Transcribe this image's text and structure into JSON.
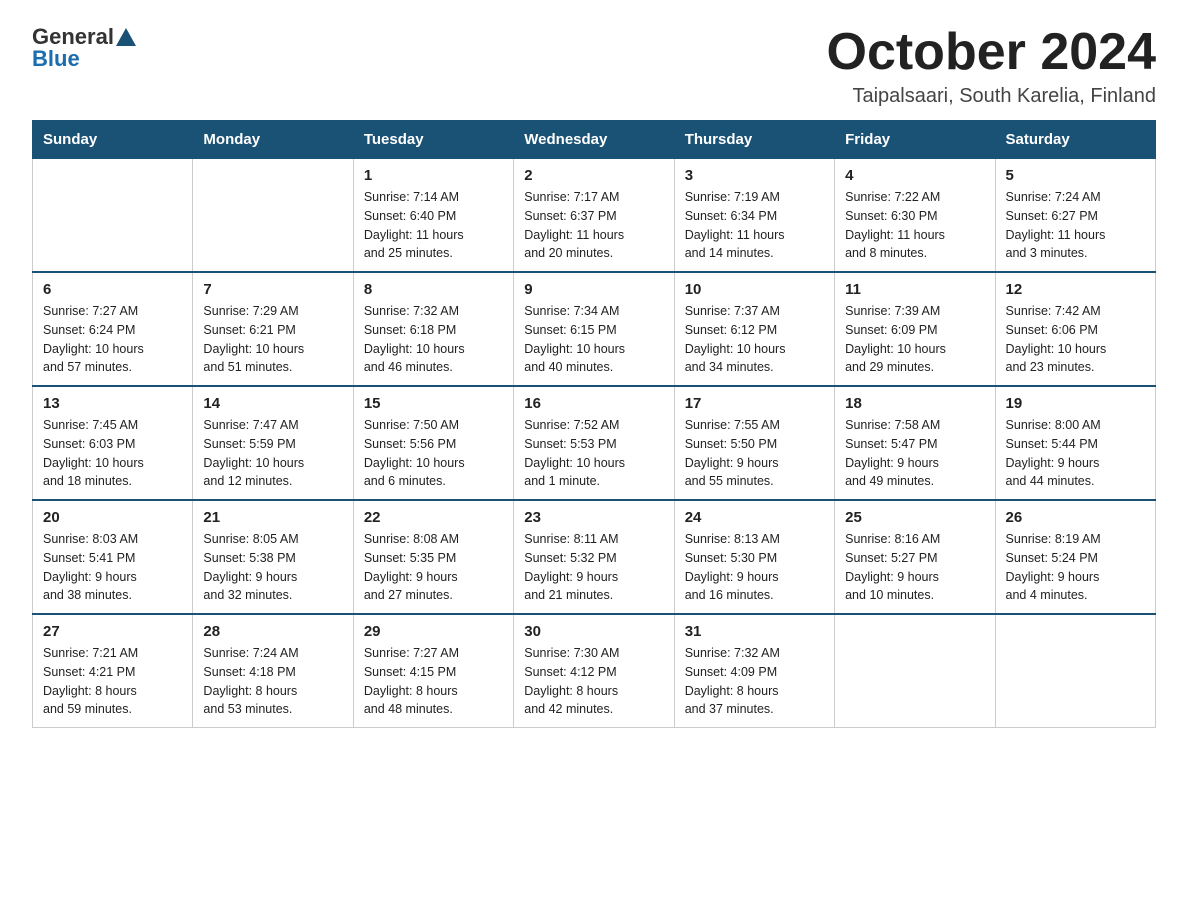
{
  "header": {
    "logo": {
      "general": "General",
      "blue": "Blue"
    },
    "month": "October 2024",
    "location": "Taipalsaari, South Karelia, Finland"
  },
  "days_of_week": [
    "Sunday",
    "Monday",
    "Tuesday",
    "Wednesday",
    "Thursday",
    "Friday",
    "Saturday"
  ],
  "weeks": [
    [
      {
        "day": "",
        "info": ""
      },
      {
        "day": "",
        "info": ""
      },
      {
        "day": "1",
        "info": "Sunrise: 7:14 AM\nSunset: 6:40 PM\nDaylight: 11 hours\nand 25 minutes."
      },
      {
        "day": "2",
        "info": "Sunrise: 7:17 AM\nSunset: 6:37 PM\nDaylight: 11 hours\nand 20 minutes."
      },
      {
        "day": "3",
        "info": "Sunrise: 7:19 AM\nSunset: 6:34 PM\nDaylight: 11 hours\nand 14 minutes."
      },
      {
        "day": "4",
        "info": "Sunrise: 7:22 AM\nSunset: 6:30 PM\nDaylight: 11 hours\nand 8 minutes."
      },
      {
        "day": "5",
        "info": "Sunrise: 7:24 AM\nSunset: 6:27 PM\nDaylight: 11 hours\nand 3 minutes."
      }
    ],
    [
      {
        "day": "6",
        "info": "Sunrise: 7:27 AM\nSunset: 6:24 PM\nDaylight: 10 hours\nand 57 minutes."
      },
      {
        "day": "7",
        "info": "Sunrise: 7:29 AM\nSunset: 6:21 PM\nDaylight: 10 hours\nand 51 minutes."
      },
      {
        "day": "8",
        "info": "Sunrise: 7:32 AM\nSunset: 6:18 PM\nDaylight: 10 hours\nand 46 minutes."
      },
      {
        "day": "9",
        "info": "Sunrise: 7:34 AM\nSunset: 6:15 PM\nDaylight: 10 hours\nand 40 minutes."
      },
      {
        "day": "10",
        "info": "Sunrise: 7:37 AM\nSunset: 6:12 PM\nDaylight: 10 hours\nand 34 minutes."
      },
      {
        "day": "11",
        "info": "Sunrise: 7:39 AM\nSunset: 6:09 PM\nDaylight: 10 hours\nand 29 minutes."
      },
      {
        "day": "12",
        "info": "Sunrise: 7:42 AM\nSunset: 6:06 PM\nDaylight: 10 hours\nand 23 minutes."
      }
    ],
    [
      {
        "day": "13",
        "info": "Sunrise: 7:45 AM\nSunset: 6:03 PM\nDaylight: 10 hours\nand 18 minutes."
      },
      {
        "day": "14",
        "info": "Sunrise: 7:47 AM\nSunset: 5:59 PM\nDaylight: 10 hours\nand 12 minutes."
      },
      {
        "day": "15",
        "info": "Sunrise: 7:50 AM\nSunset: 5:56 PM\nDaylight: 10 hours\nand 6 minutes."
      },
      {
        "day": "16",
        "info": "Sunrise: 7:52 AM\nSunset: 5:53 PM\nDaylight: 10 hours\nand 1 minute."
      },
      {
        "day": "17",
        "info": "Sunrise: 7:55 AM\nSunset: 5:50 PM\nDaylight: 9 hours\nand 55 minutes."
      },
      {
        "day": "18",
        "info": "Sunrise: 7:58 AM\nSunset: 5:47 PM\nDaylight: 9 hours\nand 49 minutes."
      },
      {
        "day": "19",
        "info": "Sunrise: 8:00 AM\nSunset: 5:44 PM\nDaylight: 9 hours\nand 44 minutes."
      }
    ],
    [
      {
        "day": "20",
        "info": "Sunrise: 8:03 AM\nSunset: 5:41 PM\nDaylight: 9 hours\nand 38 minutes."
      },
      {
        "day": "21",
        "info": "Sunrise: 8:05 AM\nSunset: 5:38 PM\nDaylight: 9 hours\nand 32 minutes."
      },
      {
        "day": "22",
        "info": "Sunrise: 8:08 AM\nSunset: 5:35 PM\nDaylight: 9 hours\nand 27 minutes."
      },
      {
        "day": "23",
        "info": "Sunrise: 8:11 AM\nSunset: 5:32 PM\nDaylight: 9 hours\nand 21 minutes."
      },
      {
        "day": "24",
        "info": "Sunrise: 8:13 AM\nSunset: 5:30 PM\nDaylight: 9 hours\nand 16 minutes."
      },
      {
        "day": "25",
        "info": "Sunrise: 8:16 AM\nSunset: 5:27 PM\nDaylight: 9 hours\nand 10 minutes."
      },
      {
        "day": "26",
        "info": "Sunrise: 8:19 AM\nSunset: 5:24 PM\nDaylight: 9 hours\nand 4 minutes."
      }
    ],
    [
      {
        "day": "27",
        "info": "Sunrise: 7:21 AM\nSunset: 4:21 PM\nDaylight: 8 hours\nand 59 minutes."
      },
      {
        "day": "28",
        "info": "Sunrise: 7:24 AM\nSunset: 4:18 PM\nDaylight: 8 hours\nand 53 minutes."
      },
      {
        "day": "29",
        "info": "Sunrise: 7:27 AM\nSunset: 4:15 PM\nDaylight: 8 hours\nand 48 minutes."
      },
      {
        "day": "30",
        "info": "Sunrise: 7:30 AM\nSunset: 4:12 PM\nDaylight: 8 hours\nand 42 minutes."
      },
      {
        "day": "31",
        "info": "Sunrise: 7:32 AM\nSunset: 4:09 PM\nDaylight: 8 hours\nand 37 minutes."
      },
      {
        "day": "",
        "info": ""
      },
      {
        "day": "",
        "info": ""
      }
    ]
  ]
}
